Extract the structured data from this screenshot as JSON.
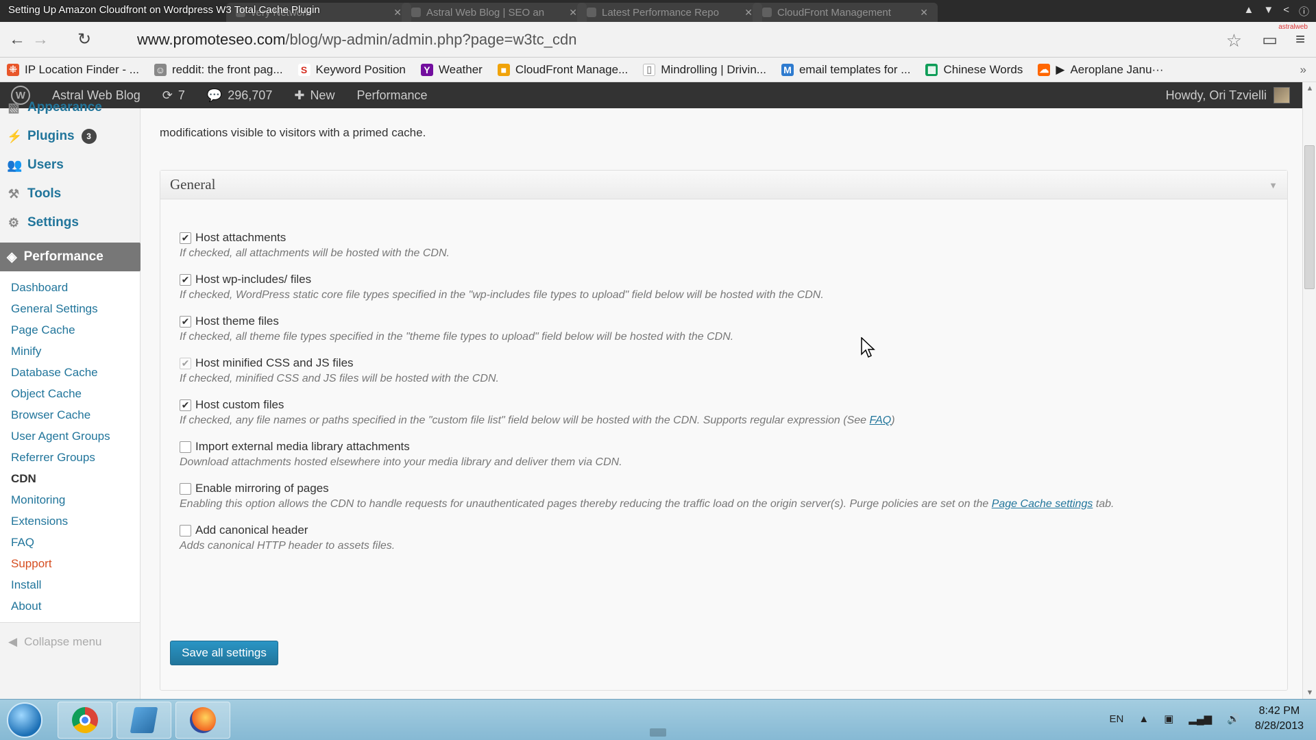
{
  "video_title": "Setting Up Amazon Cloudfront on Wordpress W3 Total Cache Plugin",
  "tabs": [
    {
      "label": "very Network"
    },
    {
      "label": "Astral Web Blog | SEO an"
    },
    {
      "label": "Latest Performance Repo"
    },
    {
      "label": "CloudFront Management"
    }
  ],
  "address": {
    "url_host": "www.promoteseo.com",
    "url_path": "/blog/wp-admin/admin.php?page=w3tc_cdn",
    "brand_mini": "astralweb"
  },
  "bookmarks": [
    {
      "label": "IP Location Finder - ...",
      "icon": "map-pin-icon",
      "color": "#e8562a"
    },
    {
      "label": "reddit: the front pag...",
      "icon": "reddit-icon",
      "color": "#888888"
    },
    {
      "label": "Keyword Position",
      "icon": "s-icon",
      "color": "#d62d20"
    },
    {
      "label": "Weather",
      "icon": "yahoo-icon",
      "color": "#720e9e"
    },
    {
      "label": "CloudFront Manage...",
      "icon": "cube-icon",
      "color": "#f0a30a"
    },
    {
      "label": "Mindrolling | Drivin...",
      "icon": "page-icon",
      "color": "#cccccc"
    },
    {
      "label": "email templates for ...",
      "icon": "mailchimp-icon",
      "color": "#2e7bcf"
    },
    {
      "label": "Chinese Words",
      "icon": "sheet-icon",
      "color": "#0f9d58"
    },
    {
      "label": "Aeroplane Janu···",
      "icon": "soundcloud-icon",
      "color": "#ff6600"
    }
  ],
  "adminbar": {
    "site_name": "Astral Web Blog",
    "updates": "7",
    "comments": "296,707",
    "new_label": "New",
    "performance_label": "Performance",
    "howdy": "Howdy, Ori Tzvielli"
  },
  "sidebar": {
    "top_items": [
      {
        "label": "Appearance",
        "icon": "appearance-icon"
      },
      {
        "label": "Plugins",
        "icon": "plugin-icon",
        "badge": "3"
      },
      {
        "label": "Users",
        "icon": "users-icon"
      },
      {
        "label": "Tools",
        "icon": "tools-icon"
      },
      {
        "label": "Settings",
        "icon": "settings-icon"
      }
    ],
    "performance_label": "Performance",
    "sub_items": [
      "Dashboard",
      "General Settings",
      "Page Cache",
      "Minify",
      "Database Cache",
      "Object Cache",
      "Browser Cache",
      "User Agent Groups",
      "Referrer Groups",
      "CDN",
      "Monitoring",
      "Extensions",
      "FAQ",
      "Support",
      "Install",
      "About"
    ],
    "current_item": "CDN",
    "collapse_label": "Collapse menu"
  },
  "main": {
    "top_note": "modifications visible to visitors with a primed cache.",
    "section_title": "General",
    "options": [
      {
        "label": "Host attachments",
        "checked": true,
        "dim": false,
        "desc": "If checked, all attachments will be hosted with the CDN."
      },
      {
        "label": "Host wp-includes/ files",
        "checked": true,
        "dim": false,
        "desc": "If checked, WordPress static core file types specified in the \"wp-includes file types to upload\" field below will be hosted with the CDN."
      },
      {
        "label": "Host theme files",
        "checked": true,
        "dim": false,
        "desc": "If checked, all theme file types specified in the \"theme file types to upload\" field below will be hosted with the CDN."
      },
      {
        "label": "Host minified CSS and JS files",
        "checked": true,
        "dim": true,
        "desc": "If checked, minified CSS and JS files will be hosted with the CDN."
      },
      {
        "label": "Host custom files",
        "checked": true,
        "dim": false,
        "desc": "If checked, any file names or paths specified in the \"custom file list\" field below will be hosted with the CDN. Supports regular expression (See ",
        "link": "FAQ",
        "desc_after": ")"
      },
      {
        "label": "Import external media library attachments",
        "checked": false,
        "dim": false,
        "desc": "Download attachments hosted elsewhere into your media library and deliver them via CDN."
      },
      {
        "label": "Enable mirroring of pages",
        "checked": false,
        "dim": false,
        "desc": "Enabling this option allows the CDN to handle requests for unauthenticated pages thereby reducing the traffic load on the origin server(s). Purge policies are set on the ",
        "link": "Page Cache settings",
        "desc_after": " tab."
      },
      {
        "label": "Add canonical header",
        "checked": false,
        "dim": false,
        "desc": "Adds canonical HTTP header to assets files."
      }
    ],
    "save_label": "Save all settings"
  },
  "taskbar": {
    "lang": "EN",
    "time": "8:42 PM",
    "date": "8/28/2013"
  }
}
